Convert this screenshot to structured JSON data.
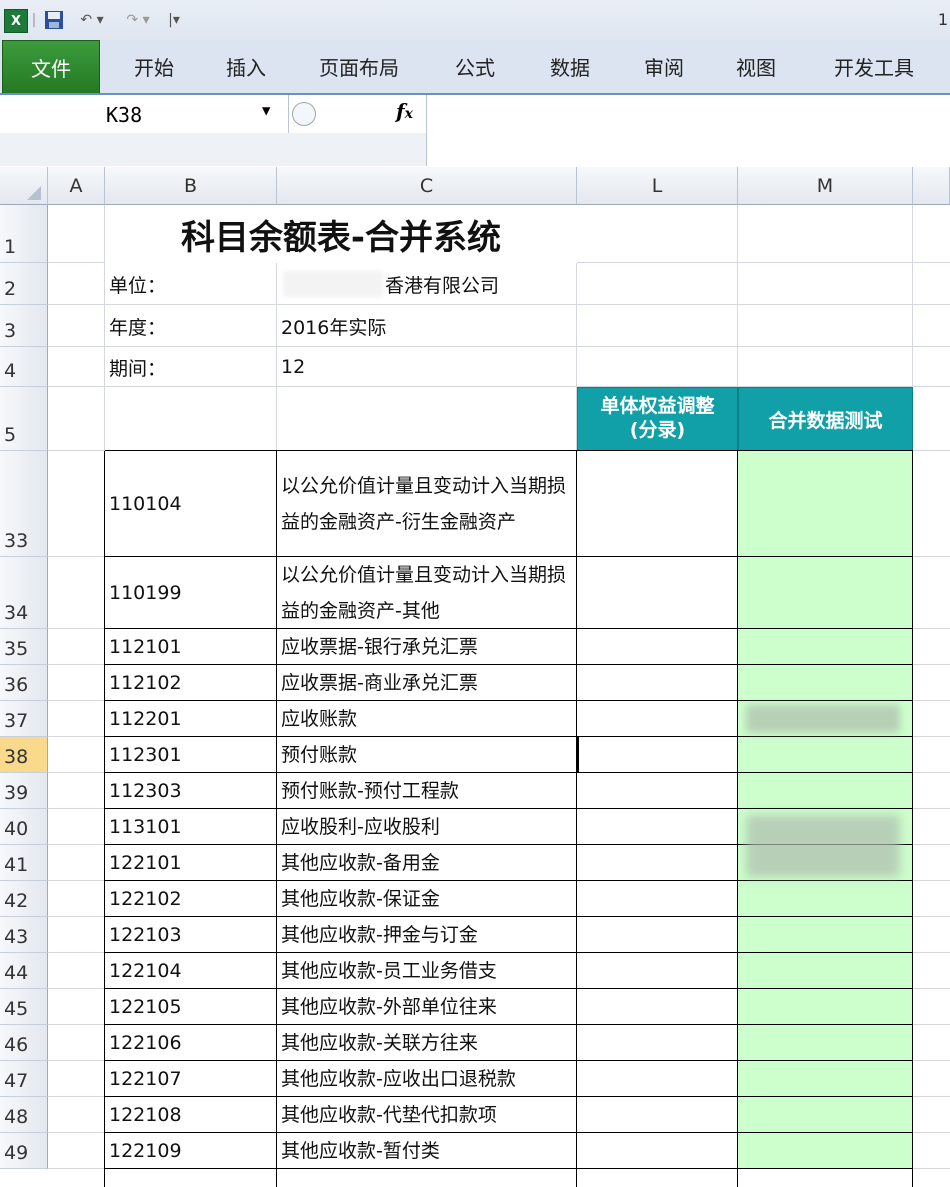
{
  "titlebar": {
    "right_number": "1"
  },
  "ribbon": {
    "tabs": [
      "文件",
      "开始",
      "插入",
      "页面布局",
      "公式",
      "数据",
      "审阅",
      "视图",
      "开发工具"
    ]
  },
  "formula_bar": {
    "name_box": "K38",
    "fx_label": "fx",
    "formula_value": ""
  },
  "columns": [
    "A",
    "B",
    "C",
    "L",
    "M"
  ],
  "header_rows": {
    "title": "科目余额表-合并系统",
    "unit_label": "单位：",
    "unit_value": "香港有限公司",
    "year_label": "年度：",
    "year_value": "2016年实际",
    "period_label": "期间：",
    "period_value": "12",
    "col_L_header": "单体权益调整\n(分录)",
    "col_M_header": "合并数据测试"
  },
  "row_numbers_top": [
    "1",
    "2",
    "3",
    "4",
    "5"
  ],
  "data_rows": [
    {
      "row": "33",
      "code": "110104",
      "name": "以公允价值计量且变动计入当期损益的金融资产-衍生金融资产"
    },
    {
      "row": "34",
      "code": "110199",
      "name": "以公允价值计量且变动计入当期损益的金融资产-其他"
    },
    {
      "row": "35",
      "code": "112101",
      "name": "应收票据-银行承兑汇票"
    },
    {
      "row": "36",
      "code": "112102",
      "name": "应收票据-商业承兑汇票"
    },
    {
      "row": "37",
      "code": "112201",
      "name": "应收账款"
    },
    {
      "row": "38",
      "code": "112301",
      "name": "预付账款"
    },
    {
      "row": "39",
      "code": "112303",
      "name": "预付账款-预付工程款"
    },
    {
      "row": "40",
      "code": "113101",
      "name": "应收股利-应收股利"
    },
    {
      "row": "41",
      "code": "122101",
      "name": "其他应收款-备用金"
    },
    {
      "row": "42",
      "code": "122102",
      "name": "其他应收款-保证金"
    },
    {
      "row": "43",
      "code": "122103",
      "name": "其他应收款-押金与订金"
    },
    {
      "row": "44",
      "code": "122104",
      "name": "其他应收款-员工业务借支"
    },
    {
      "row": "45",
      "code": "122105",
      "name": "其他应收款-外部单位往来"
    },
    {
      "row": "46",
      "code": "122106",
      "name": "其他应收款-关联方往来"
    },
    {
      "row": "47",
      "code": "122107",
      "name": "其他应收款-应收出口退税款"
    },
    {
      "row": "48",
      "code": "122108",
      "name": "其他应收款-代垫代扣款项"
    },
    {
      "row": "49",
      "code": "122109",
      "name": "其他应收款-暂付类"
    }
  ],
  "colors": {
    "header_fill": "#11a0a8",
    "green_fill": "#ccffcc",
    "selected_row_header": "#f9d98b",
    "file_tab": "#2e8b2e"
  }
}
